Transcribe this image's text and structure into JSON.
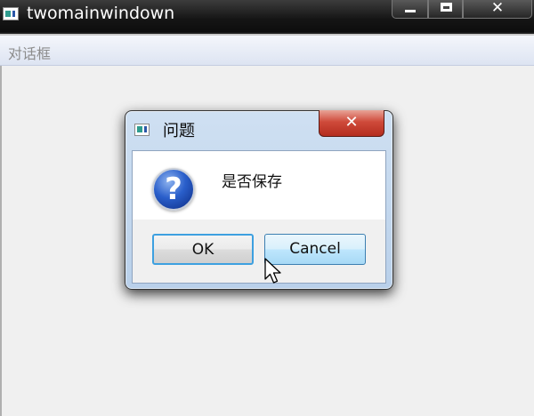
{
  "window": {
    "title": "twomainwindown",
    "controls": {
      "close_glyph": "✕"
    }
  },
  "menubar": {
    "items": [
      "对话框"
    ]
  },
  "dialog": {
    "title": "问题",
    "message": "是否保存",
    "icon": "question-icon",
    "icon_glyph": "?",
    "close_glyph": "✕",
    "buttons": {
      "ok_label": "OK",
      "cancel_label": "Cancel"
    },
    "focused_button": "OK",
    "hovered_button": "Cancel"
  },
  "colors": {
    "close_button": "#c8493a",
    "ok_focus_border": "#3da0e0",
    "cancel_hover_bg": "#bee6fd",
    "dialog_frame": "#b9d0ea"
  }
}
